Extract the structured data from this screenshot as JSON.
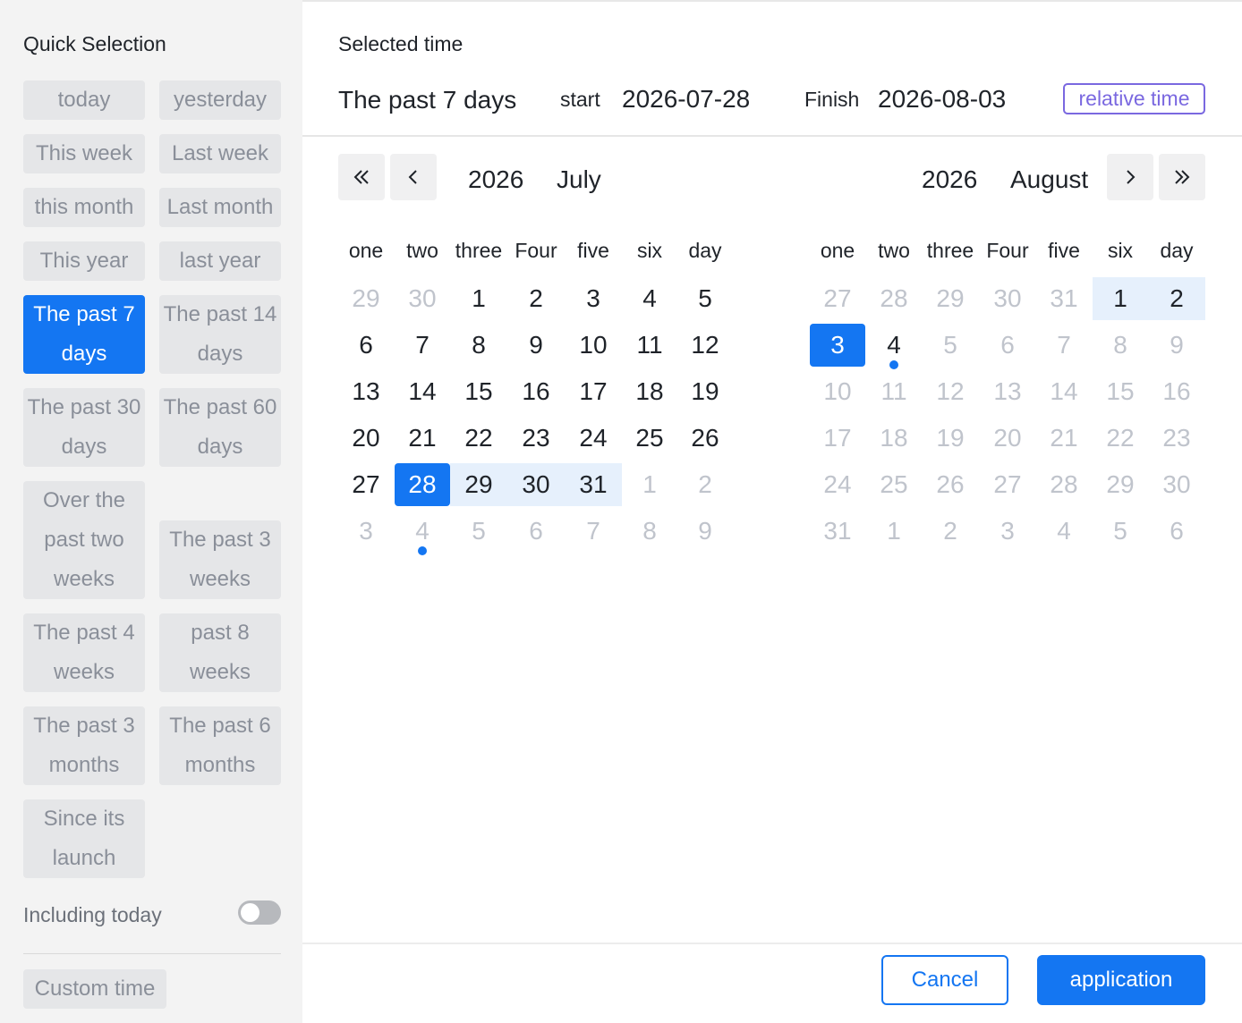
{
  "sidebar": {
    "title": "Quick Selection",
    "quick_options": [
      {
        "label": "today"
      },
      {
        "label": "yesterday"
      },
      {
        "label": "This week"
      },
      {
        "label": "Last week"
      },
      {
        "label": "this month"
      },
      {
        "label": "Last month"
      },
      {
        "label": "This year"
      },
      {
        "label": "last year"
      },
      {
        "label": "The past 7 days",
        "active": true
      },
      {
        "label": "The past 14 days"
      },
      {
        "label": "The past 30 days"
      },
      {
        "label": "The past 60 days"
      },
      {
        "label": "Over the past two weeks"
      },
      {
        "label": "The past 3 weeks"
      },
      {
        "label": "The past 4 weeks"
      },
      {
        "label": "past 8 weeks"
      },
      {
        "label": "The past 3 months"
      },
      {
        "label": "The past 6 months"
      },
      {
        "label": "Since its launch"
      }
    ],
    "including_today": {
      "label": "Including today",
      "on": false
    },
    "custom_time_label": "Custom time"
  },
  "header": {
    "label": "Selected time",
    "range_name": "The past 7 days",
    "start_label": "start",
    "start_value": "2026-07-28",
    "finish_label": "Finish",
    "finish_value": "2026-08-03",
    "relative_time_label": "relative time"
  },
  "calendars": [
    {
      "year": "2026",
      "month": "July",
      "weekdays": [
        "one",
        "two",
        "three",
        "Four",
        "five",
        "six",
        "day"
      ],
      "weeks": [
        [
          "29",
          "30",
          "1",
          "2",
          "3",
          "4",
          "5"
        ],
        [
          "6",
          "7",
          "8",
          "9",
          "10",
          "11",
          "12"
        ],
        [
          "13",
          "14",
          "15",
          "16",
          "17",
          "18",
          "19"
        ],
        [
          "20",
          "21",
          "22",
          "23",
          "24",
          "25",
          "26"
        ],
        [
          "27",
          "28",
          "29",
          "30",
          "31",
          "1",
          "2"
        ],
        [
          "3",
          "4",
          "5",
          "6",
          "7",
          "8",
          "9"
        ]
      ]
    },
    {
      "year": "2026",
      "month": "August",
      "weekdays": [
        "one",
        "two",
        "three",
        "Four",
        "five",
        "six",
        "day"
      ],
      "weeks": [
        [
          "27",
          "28",
          "29",
          "30",
          "31",
          "1",
          "2"
        ],
        [
          "3",
          "4",
          "5",
          "6",
          "7",
          "8",
          "9"
        ],
        [
          "10",
          "11",
          "12",
          "13",
          "14",
          "15",
          "16"
        ],
        [
          "17",
          "18",
          "19",
          "20",
          "21",
          "22",
          "23"
        ],
        [
          "24",
          "25",
          "26",
          "27",
          "28",
          "29",
          "30"
        ],
        [
          "31",
          "1",
          "2",
          "3",
          "4",
          "5",
          "6"
        ]
      ]
    }
  ],
  "footer": {
    "cancel_label": "Cancel",
    "apply_label": "application"
  },
  "colors": {
    "accent": "#1476f2",
    "range_fill": "#e6f0fc",
    "relative_time": "#7a68e0"
  }
}
